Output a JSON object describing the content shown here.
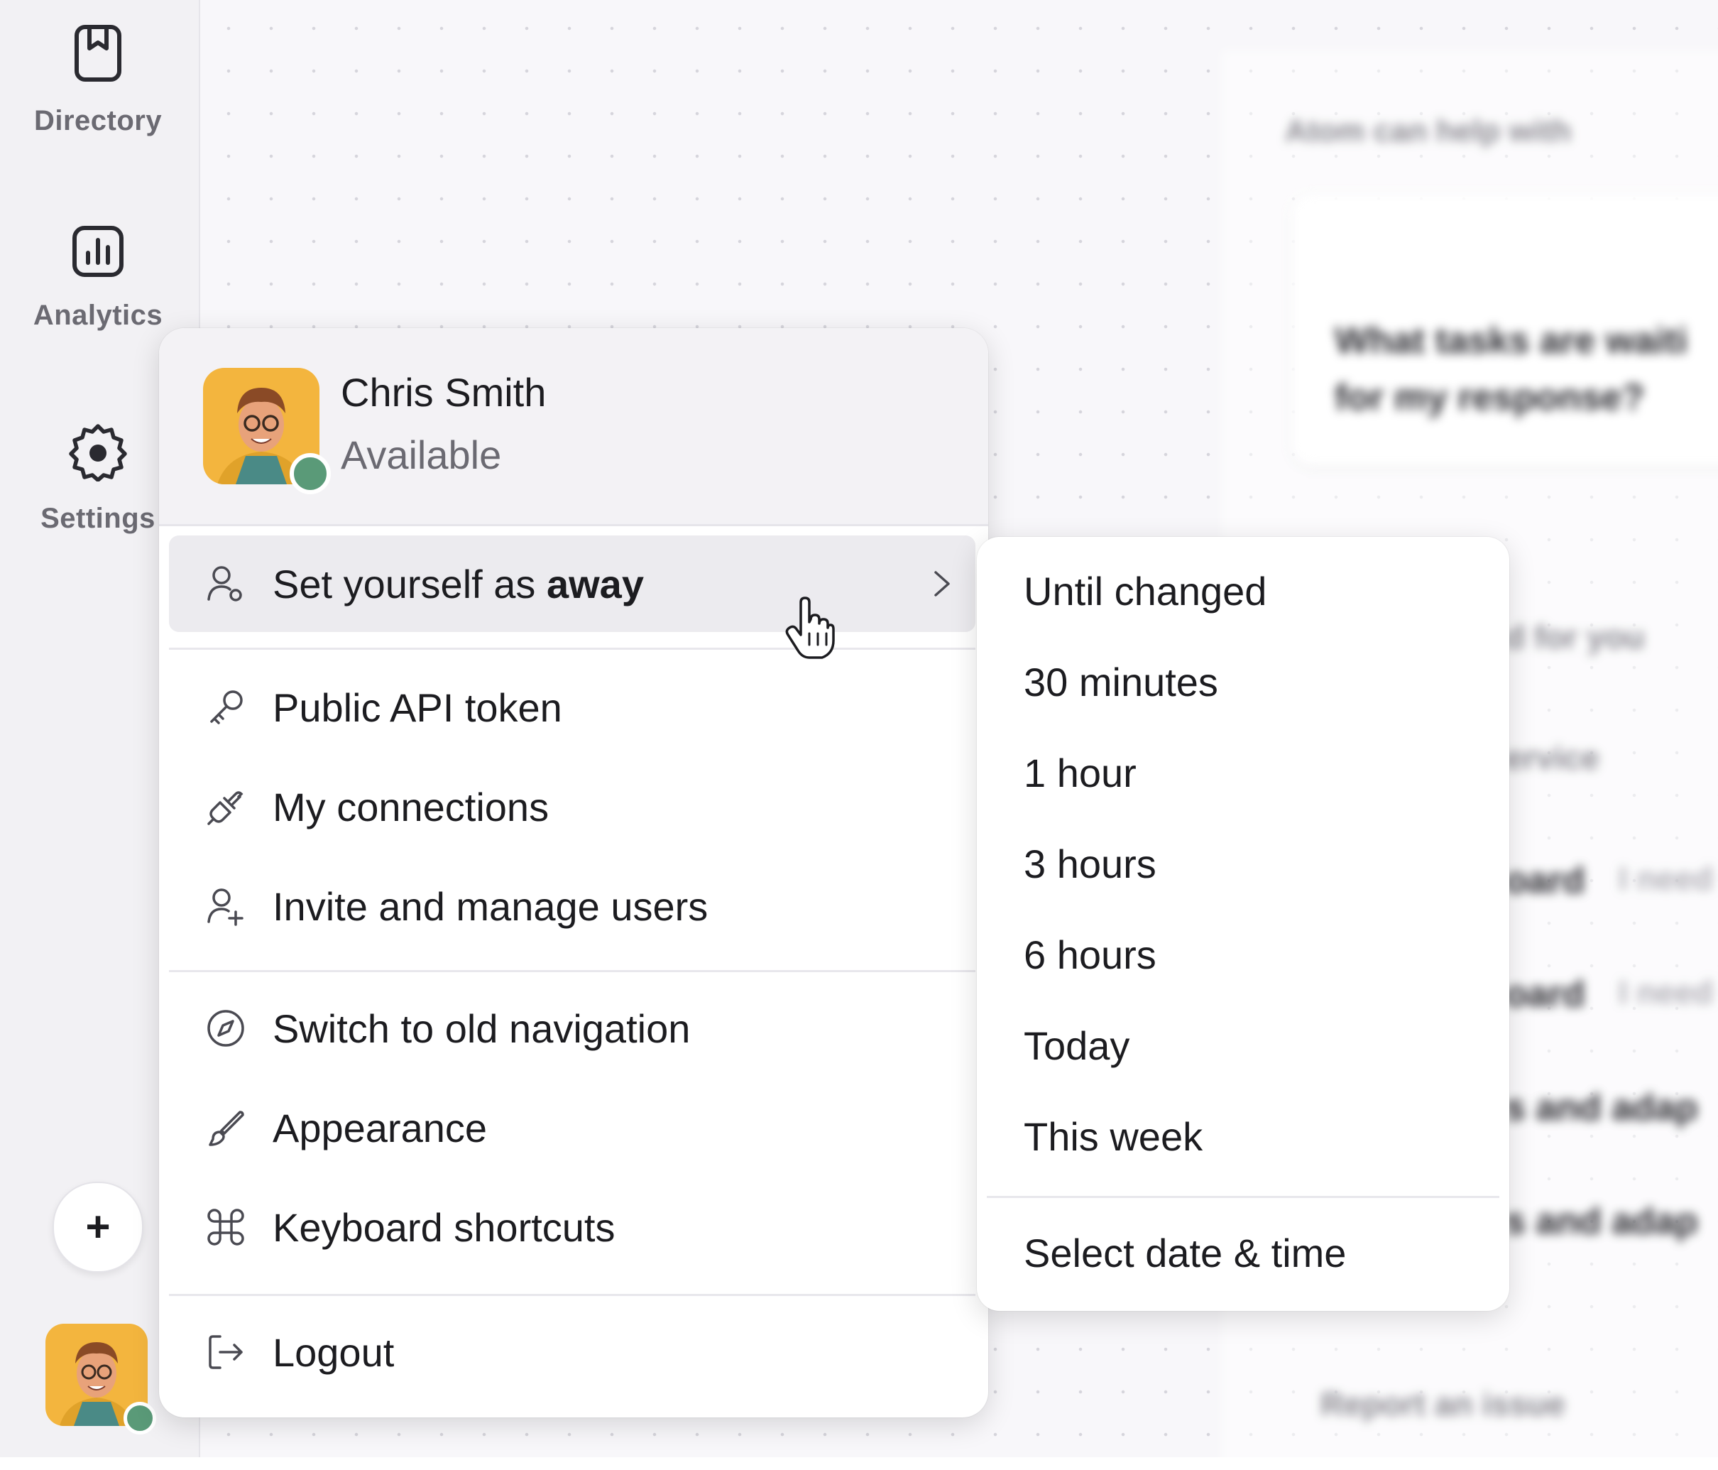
{
  "sidebar": {
    "items": [
      {
        "label": "Directory",
        "icon": "bookmark-icon"
      },
      {
        "label": "Analytics",
        "icon": "chart-icon"
      },
      {
        "label": "Settings",
        "icon": "gear-icon"
      }
    ],
    "add_label": "+"
  },
  "background": {
    "heading": "Atom can help with",
    "card_text_1": "What tasks are waiti",
    "card_text_2": "for my response?",
    "row_1": "d for you",
    "row_2": "ervice",
    "row_3": "oard",
    "row_3b": "I need",
    "row_4": "oard",
    "row_4b": "I need",
    "row_5": "s and adap",
    "row_6": "s and adap",
    "footer": "Report an issue"
  },
  "user": {
    "name": "Chris Smith",
    "status": "Available",
    "status_color": "#5a9a78"
  },
  "menu": {
    "away": {
      "prefix": "Set yourself as ",
      "bold": "away"
    },
    "items": [
      {
        "label": "Public API token",
        "icon": "key-icon"
      },
      {
        "label": "My connections",
        "icon": "plug-icon"
      },
      {
        "label": "Invite and manage users",
        "icon": "user-plus-icon"
      },
      {
        "label": "Switch to old navigation",
        "icon": "compass-icon"
      },
      {
        "label": "Appearance",
        "icon": "brush-icon"
      },
      {
        "label": "Keyboard shortcuts",
        "icon": "command-icon"
      },
      {
        "label": "Logout",
        "icon": "logout-icon"
      }
    ]
  },
  "submenu": {
    "options": [
      "Until changed",
      "30 minutes",
      "1 hour",
      "3 hours",
      "6 hours",
      "Today",
      "This week"
    ],
    "custom": "Select date & time"
  }
}
